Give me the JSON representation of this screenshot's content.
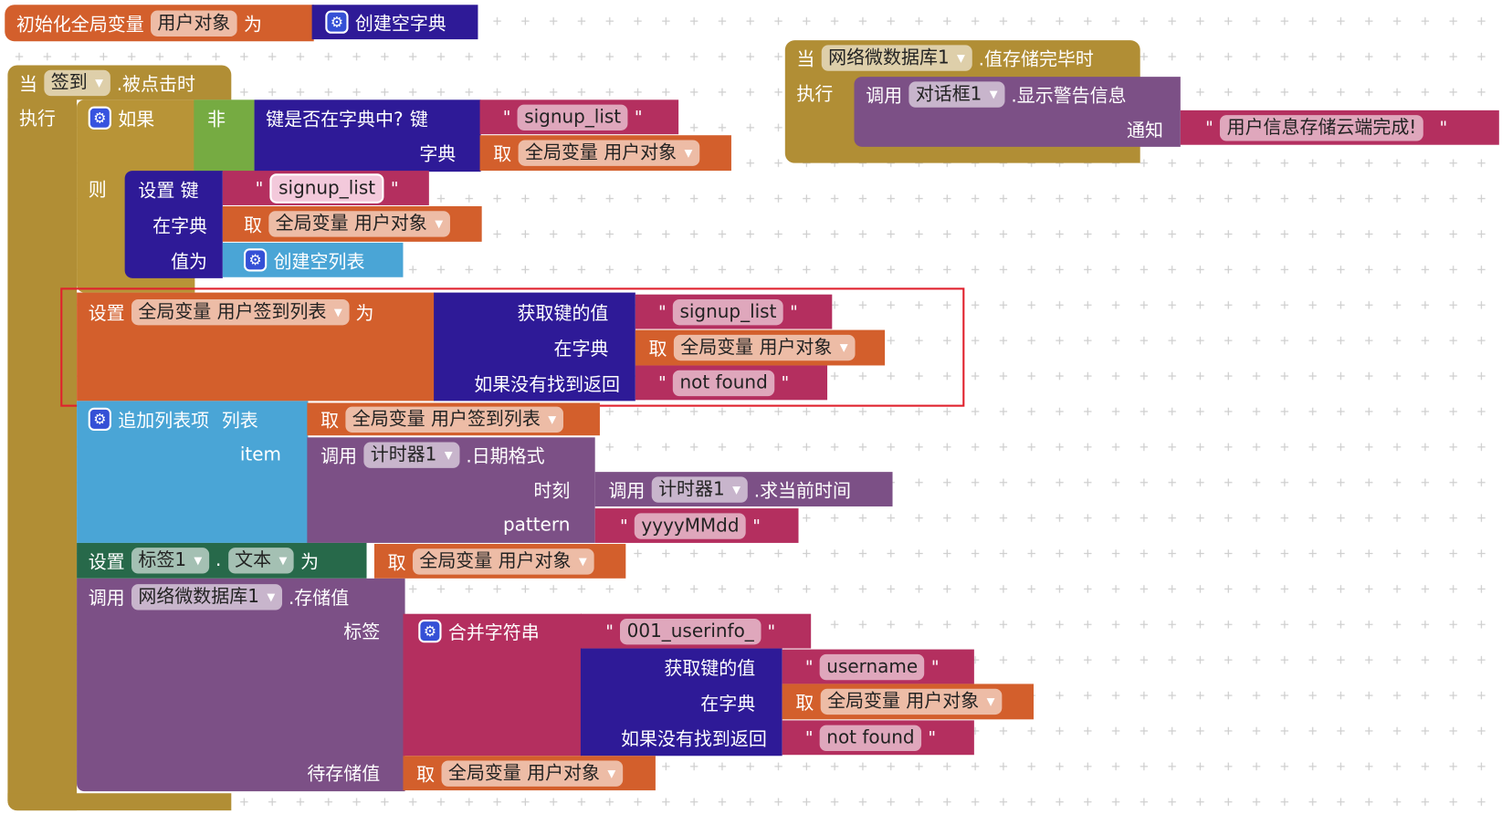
{
  "colors": {
    "variable": "#d35f2c",
    "dictionary": "#2e1a97",
    "text": "#b42f5f",
    "control": "#b18e35",
    "logic": "#76ab42",
    "list": "#4aa5d6",
    "component_method": "#7c5086",
    "component_setter": "#27694a",
    "highlight": "#e0212d"
  },
  "init_global": {
    "label": "初始化全局变量",
    "var_name": "用户对象",
    "to": "为",
    "value_block": "创建空字典"
  },
  "click_event": {
    "when": "当",
    "component": "签到",
    "event": ".被点击时",
    "do": "执行",
    "if_block": {
      "if": "如果",
      "then": "则",
      "not": "非",
      "contains_key": "键是否在字典中?",
      "key_label": "键",
      "dict_label": "字典",
      "key_text": "signup_list",
      "get": "取",
      "var": "全局变量 用户对象",
      "set_key": "设置 键",
      "in_dict": "在字典",
      "value_label": "值为",
      "set_key_text": "signup_list",
      "set_dict_var": "全局变量 用户对象",
      "empty_list": "创建空列表"
    },
    "set_global": {
      "set": "设置",
      "var": "全局变量 用户签到列表",
      "to": "为",
      "get_value": "获取键的值",
      "in_dict": "在字典",
      "if_not_found": "如果没有找到返回",
      "key_text": "signup_list",
      "get": "取",
      "dict_var": "全局变量 用户对象",
      "not_found_text": "not found"
    },
    "add_items": {
      "label": "追加列表项",
      "list_label": "列表",
      "item_label": "item",
      "get": "取",
      "list_var": "全局变量 用户签到列表",
      "call": "调用",
      "timer": "计时器1",
      "format_date": ".日期格式",
      "instant_label": "时刻",
      "now_call": "调用",
      "now_timer": "计时器1",
      "now": ".求当前时间",
      "pattern_label": "pattern",
      "pattern_text": "yyyyMMdd"
    },
    "set_label": {
      "set": "设置",
      "component": "标签1",
      "dot": ".",
      "property": "文本",
      "to": "为",
      "get": "取",
      "var": "全局变量 用户对象"
    },
    "store_value": {
      "call": "调用",
      "component": "网络微数据库1",
      "method": ".存储值",
      "tag_label": "标签",
      "value_label": "待存储值",
      "join": "合并字符串",
      "prefix_text": "001_userinfo_",
      "get_value": "获取键的值",
      "in_dict": "在字典",
      "if_not_found": "如果没有找到返回",
      "key_text": "username",
      "get": "取",
      "dict_var": "全局变量 用户对象",
      "not_found_text": "not found",
      "value_var": "全局变量 用户对象"
    }
  },
  "stored_event": {
    "when": "当",
    "component": "网络微数据库1",
    "event": ".值存储完毕时",
    "do": "执行",
    "call": "调用",
    "dialog": "对话框1",
    "method": ".显示警告信息",
    "notice_label": "通知",
    "message_text": "用户信息存储云端完成!"
  }
}
